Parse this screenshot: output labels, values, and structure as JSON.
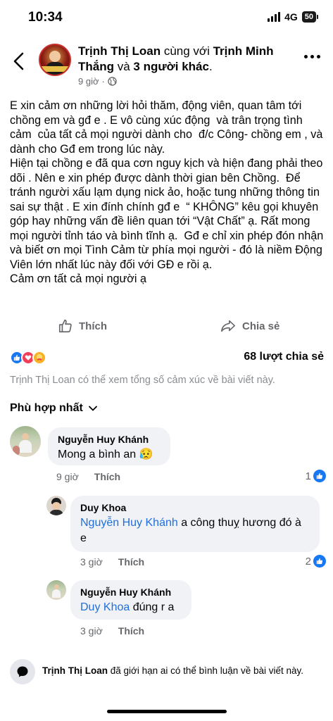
{
  "status_bar": {
    "time": "10:34",
    "network": "4G",
    "battery": "50"
  },
  "header": {
    "author": "Trịnh Thị Loan",
    "with_text": " cùng với ",
    "tagged": "Trịnh Minh Thắng",
    "and_text": " và ",
    "others": "3 người khác",
    "period": ".",
    "time": "9 giờ",
    "separator": "·"
  },
  "post": {
    "text": "E xin cảm ơn những lời hỏi thăm, động viên, quan tâm tới chồng em và gđ e . E vô cùng xúc động  và trân trọng tình cảm  của tất cả mọi người dành cho  đ/c Công- chồng em , và dành cho Gđ em trong lúc này.\nHiện tại chồng e đã qua cơn nguy kịch và hiện đang phải theo dõi . Nên e xin phép được dành thời gian bên Chồng.  Để tránh người xấu lạm dụng nick ảo, hoặc tung những thông tin sai sự thật . E xin đính chính gđ e  “ KHÔNG” kêu gọi khuyên góp hay những vấn đề liên quan tới “Vật Chất” ạ. Rất mong mọi người tỉnh táo và bình tĩnh ạ.  Gđ e chỉ xin phép đón nhận và biết ơn mọi Tình Cảm từ phía mọi người - đó là niềm Động Viên lớn nhất lúc này đối với GĐ e rồi ạ.\nCảm ơn tất cả mọi người ạ"
  },
  "actions": {
    "like_label": "Thích",
    "share_label": "Chia sẻ"
  },
  "reactions": {
    "share_count": "68 lượt chia sẻ",
    "note": "Trịnh Thị Loan có thể xem tổng số cảm xúc về bài viết này."
  },
  "sort": {
    "label": "Phù hợp nhất"
  },
  "comments": [
    {
      "name": "Nguyễn Huy Khánh",
      "mention": "",
      "text": "Mong a bình an 😥",
      "time": "9 giờ",
      "reply": "Thích",
      "likes": "1"
    },
    {
      "name": "Duy Khoa",
      "mention": "Nguyễn Huy Khánh",
      "text": " a công thuỵ hương đó à e",
      "time": "3 giờ",
      "reply": "Thích",
      "likes": "2"
    },
    {
      "name": "Nguyễn Huy Khánh",
      "mention": "Duy Khoa",
      "text": " đúng r a",
      "time": "3 giờ",
      "reply": "Thích",
      "likes": ""
    }
  ],
  "restriction": {
    "name": "Trịnh Thị Loan",
    "text": " đã giới hạn ai có thể bình luận về bài viết này."
  },
  "colors": {
    "accent": "#1877f2",
    "mention": "#216fdb",
    "bubble": "#f0f2f5",
    "muted": "#65676b"
  }
}
